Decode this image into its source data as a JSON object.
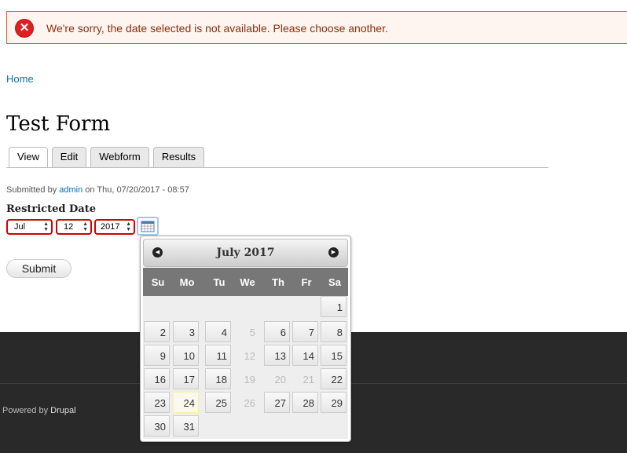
{
  "message": {
    "text": "We're sorry, the date selected is not available. Please choose another.",
    "icon": "error-icon"
  },
  "breadcrumb": {
    "home": "Home"
  },
  "page": {
    "title": "Test Form"
  },
  "tabs": [
    {
      "label": "View",
      "active": true
    },
    {
      "label": "Edit",
      "active": false
    },
    {
      "label": "Webform",
      "active": false
    },
    {
      "label": "Results",
      "active": false
    }
  ],
  "submitted": {
    "prefix": "Submitted by",
    "user": "admin",
    "suffix": "on Thu, 07/20/2017 - 08:57"
  },
  "field": {
    "label": "Restricted Date",
    "month": "Jul",
    "day": "12",
    "year": "2017"
  },
  "submit_label": "Submit",
  "calendar": {
    "title": "July 2017",
    "weekdays": [
      "Su",
      "Mo",
      "Tu",
      "We",
      "Th",
      "Fr",
      "Sa"
    ],
    "days": [
      {
        "n": "1",
        "ok": true
      },
      {
        "n": "2",
        "ok": true
      },
      {
        "n": "3",
        "ok": true
      },
      {
        "n": "4",
        "ok": true
      },
      {
        "n": "5",
        "ok": false
      },
      {
        "n": "6",
        "ok": true
      },
      {
        "n": "7",
        "ok": true
      },
      {
        "n": "8",
        "ok": true
      },
      {
        "n": "9",
        "ok": true
      },
      {
        "n": "10",
        "ok": true
      },
      {
        "n": "11",
        "ok": true
      },
      {
        "n": "12",
        "ok": false
      },
      {
        "n": "13",
        "ok": true
      },
      {
        "n": "14",
        "ok": true
      },
      {
        "n": "15",
        "ok": true
      },
      {
        "n": "16",
        "ok": true
      },
      {
        "n": "17",
        "ok": true
      },
      {
        "n": "18",
        "ok": true
      },
      {
        "n": "19",
        "ok": false
      },
      {
        "n": "20",
        "ok": false
      },
      {
        "n": "21",
        "ok": false
      },
      {
        "n": "22",
        "ok": true
      },
      {
        "n": "23",
        "ok": true
      },
      {
        "n": "24",
        "ok": true,
        "today": true
      },
      {
        "n": "25",
        "ok": true
      },
      {
        "n": "26",
        "ok": false
      },
      {
        "n": "27",
        "ok": true
      },
      {
        "n": "28",
        "ok": true
      },
      {
        "n": "29",
        "ok": true
      },
      {
        "n": "30",
        "ok": true
      },
      {
        "n": "31",
        "ok": true
      }
    ]
  },
  "footer": {
    "powered_by": "Powered by",
    "drupal": "Drupal"
  }
}
